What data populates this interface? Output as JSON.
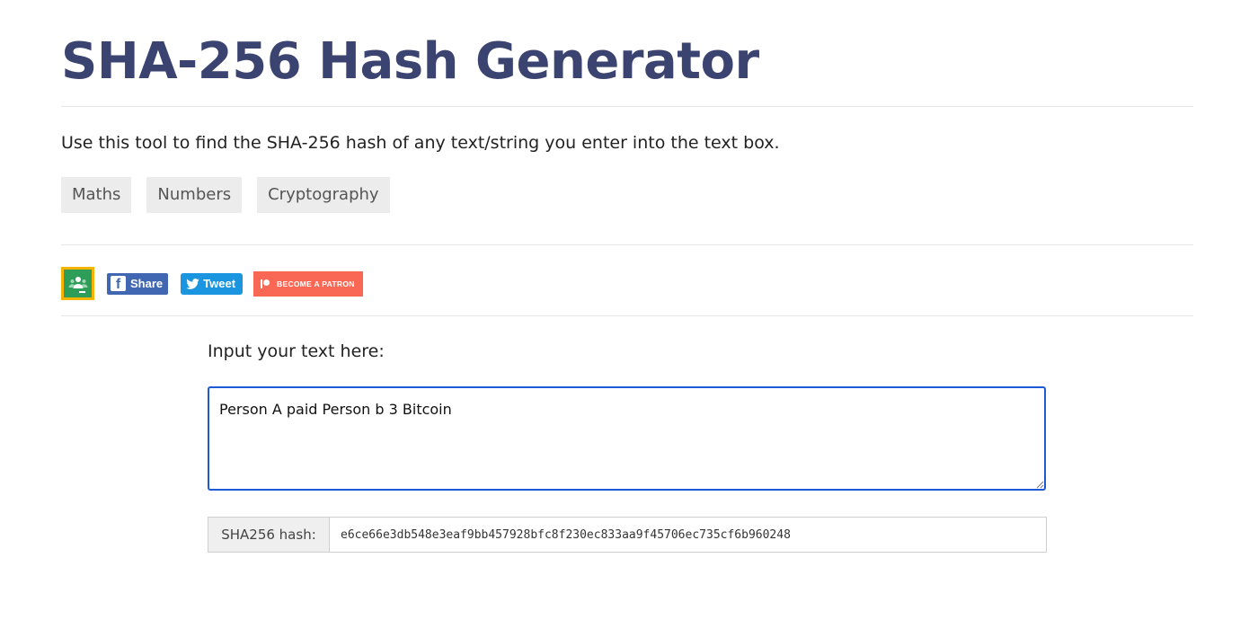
{
  "page": {
    "title": "SHA-256 Hash Generator",
    "description": "Use this tool to find the SHA-256 hash of any text/string you enter into the text box."
  },
  "tags": [
    {
      "label": "Maths"
    },
    {
      "label": "Numbers"
    },
    {
      "label": "Cryptography"
    }
  ],
  "social": {
    "share_label": "Share",
    "tweet_label": "Tweet",
    "patron_label": "BECOME A PATRON",
    "classroom_icon": "google-classroom-icon",
    "colors": {
      "classroom_bg": "#2e9d57",
      "classroom_border": "#f6b400",
      "facebook": "#4267b2",
      "twitter": "#1b95e0",
      "patreon": "#f96854"
    }
  },
  "input": {
    "label": "Input your text here:",
    "value": "Person A paid Person b 3 Bitcoin"
  },
  "output": {
    "label": "SHA256 hash:",
    "value": "e6ce66e3db548e3eaf9bb457928bfc8f230ec833aa9f45706ec735cf6b960248"
  },
  "colors": {
    "title": "#3b4370",
    "focus_border": "#1e5ad6",
    "tag_bg": "#ececec"
  }
}
